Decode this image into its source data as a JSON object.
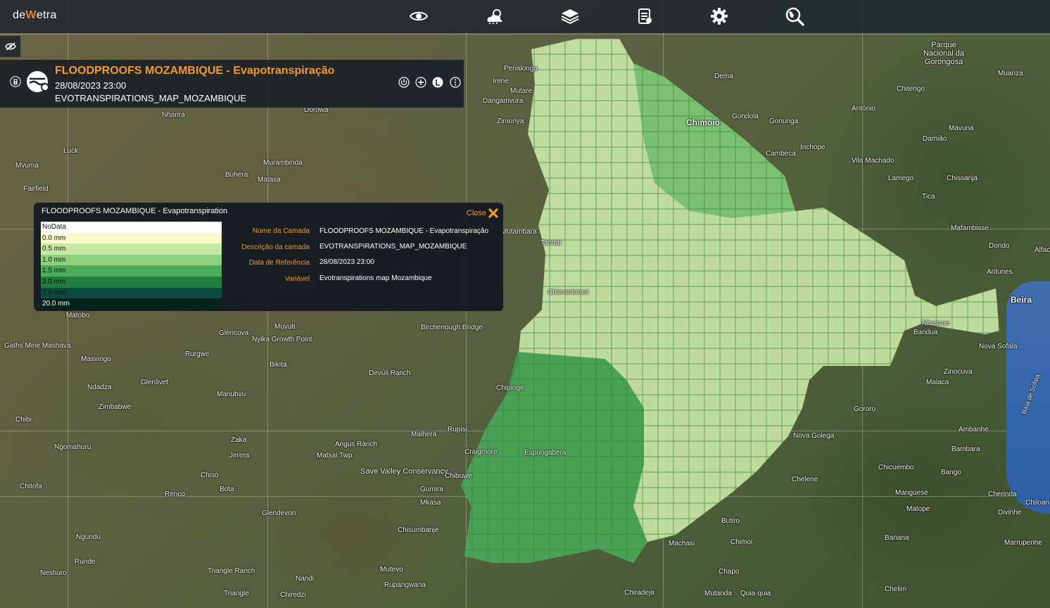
{
  "app": {
    "logo_part1": "de",
    "logo_part2": "W",
    "logo_part3": "etra"
  },
  "toolbar": {
    "icons": [
      "eye-icon",
      "weather-icon",
      "layers-icon",
      "report-icon",
      "gear-icon",
      "globe-search-icon"
    ]
  },
  "layer_card": {
    "title": "FLOODPROOFS MOZAMBIQUE - Evapotranspiração",
    "date": "28/08/2023 23:00",
    "id": "EVOTRANSPIRATIONS_MAP_MOZAMBIQUE"
  },
  "legend_popup": {
    "title": "FLOODPROOFS MOZAMBIQUE - Evapotranspiration",
    "close_label": "Close",
    "scale": [
      {
        "label": "NoData",
        "color": "#ffffff",
        "text_color": "#111111"
      },
      {
        "label": "0.0 mm",
        "color": "#fbf9cb",
        "text_color": "#111111"
      },
      {
        "label": "0.5 mm",
        "color": "#c6e8a2",
        "text_color": "#111111"
      },
      {
        "label": "1.0 mm",
        "color": "#8fd07f",
        "text_color": "#111111"
      },
      {
        "label": "1.5 mm",
        "color": "#4cac5b",
        "text_color": "#111111"
      },
      {
        "label": "3.0 mm",
        "color": "#1f7d3d",
        "text_color": "#111111"
      },
      {
        "label": "7.0 mm",
        "color": "#0c4b3f",
        "text_color": "#111111"
      },
      {
        "label": "20.0 mm",
        "color": "#06221c",
        "text_color": "#ffffff"
      }
    ],
    "fields": [
      {
        "label": "Nome da Camada",
        "value": "FLOODPROOFS MOZAMBIQUE - Evapotranspiração"
      },
      {
        "label": "Descrição da camada",
        "value": "EVOTRANSPIRATIONS_MAP_MOZAMBIQUE"
      },
      {
        "label": "Data de Referência",
        "value": "28/08/2023 23:00"
      },
      {
        "label": "Variável",
        "value": "Evotranspirations map Mozambique"
      }
    ]
  },
  "colors": {
    "accent": "#f39a2e",
    "panel": "#1c222c",
    "sea": "#3a6aae"
  },
  "map_places": [
    "Penalonga",
    "Irene",
    "Mutare",
    "Dangamvura",
    "Zimunya",
    "Nharira",
    "Dorowa",
    "Luck",
    "Mvuma",
    "Fairfield",
    "Murambinda",
    "Buhera",
    "Matasa",
    "Mutambara",
    "Tandai",
    "Chipinge",
    "Chimanimani",
    "Chiredzi",
    "Birchenough Bridge",
    "Muvuti",
    "Nyika Growth Point",
    "Bikita",
    "Glencova",
    "Devuli Ranch",
    "Matobo",
    "Gaths Mine Mashava",
    "Masvingo",
    "Rurgwe",
    "Ndadza",
    "Zimbabwe",
    "Glenlivet",
    "Manubvu",
    "Chibi",
    "Ngomahuru",
    "Zaka",
    "Jerera",
    "Angus Ranch",
    "Matsai Twp",
    "Save Valley Conservancy",
    "Malhera",
    "Rupisi",
    "Chiso",
    "Chitofa",
    "Bota",
    "Renco",
    "Glendevon",
    "Ngundu",
    "Runde",
    "Neshuro",
    "Triangle Ranch",
    "Triangle",
    "Nandi",
    "Mutevo",
    "Rupangwana",
    "Mkasa",
    "Chisumbanje",
    "Gumira",
    "Chibuwe",
    "Craigmore",
    "Espungabera",
    "Dema",
    "Chimoio",
    "Gondola",
    "Gonunga",
    "Cambeca",
    "Inchope",
    "Chitengo",
    "António",
    "Mavuna",
    "Damião",
    "Vila Machado",
    "Lamego",
    "Chissanja",
    "Tica",
    "Mafambisse",
    "Dondo",
    "Antunes",
    "Beira",
    "Nova Sofala",
    "Muanza",
    "Parque Nacional da Gorongosa",
    "Zinocuva",
    "Malaca",
    "Gororo",
    "Nova Golega",
    "Ambanhe",
    "Bambara",
    "Chicuembo",
    "Chelene",
    "Manguese",
    "Matope",
    "Bango",
    "Cherinda",
    "Divinhe",
    "Banana",
    "Marrupenhe",
    "Machasi",
    "Chimoi",
    "Chapo",
    "Chiradeja",
    "Mutanda",
    "Quia-quia",
    "Chelim",
    "Butiro",
    "Baía de Sofala",
    "Nhassue",
    "Bandua",
    "Alfac",
    "Chiloan"
  ]
}
